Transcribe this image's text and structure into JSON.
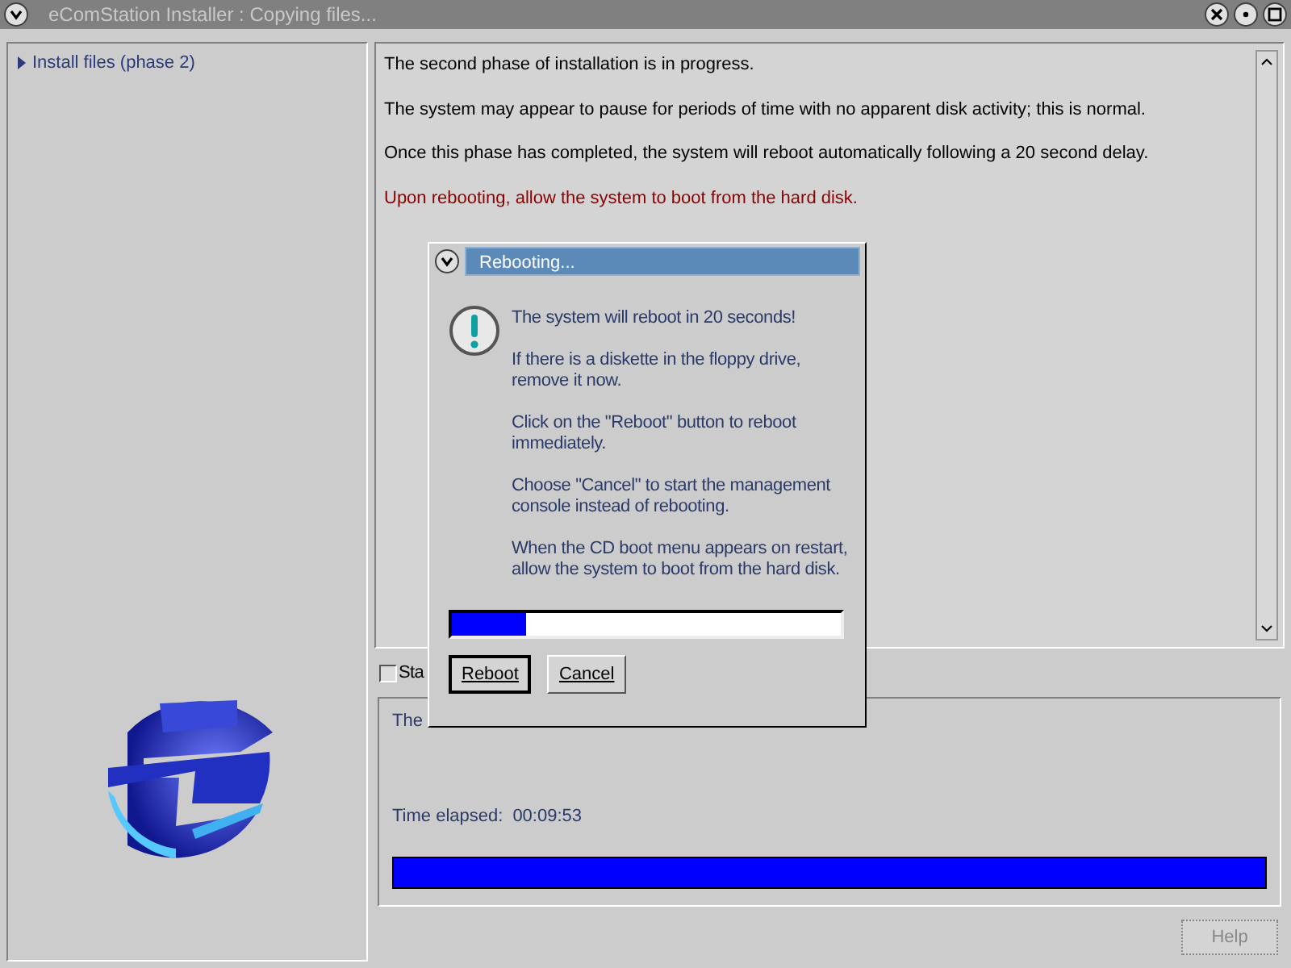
{
  "window": {
    "title": "eComStation Installer : Copying files..."
  },
  "sidebar": {
    "items": [
      {
        "label": "Install files (phase 2)",
        "selected": true
      }
    ]
  },
  "messages": [
    {
      "text": "The second phase of installation is in progress.",
      "kind": "normal"
    },
    {
      "text": "The system may appear to pause for periods of time with no apparent disk activity; this is normal.",
      "kind": "normal"
    },
    {
      "text": "Once this phase has completed, the system will reboot automatically following a 20 second delay.",
      "kind": "normal"
    },
    {
      "text": "Upon rebooting, allow the system to boot from the hard disk.",
      "kind": "warning"
    }
  ],
  "checkbox": {
    "label": "Sta",
    "checked": false
  },
  "status": {
    "text": "The",
    "elapsed_label": "Time elapsed:",
    "elapsed": "00:09:53",
    "level": 1
  },
  "help_button": {
    "label": "Help",
    "disabled": true
  },
  "dialog": {
    "title": "Rebooting...",
    "paragraphs": [
      "The system will reboot in 20 seconds!",
      "If there is a diskette in the floppy drive, remove it now.",
      "Click on the \"Reboot\" button to reboot immediately.",
      "Choose \"Cancel\" to start the management console instead of rebooting.",
      "When the CD boot menu appears on restart, allow the system to boot from the hard disk."
    ],
    "level": 0.19,
    "buttons": [
      {
        "label": "Reboot",
        "default": true
      },
      {
        "label": "Cancel",
        "default": false
      }
    ]
  }
}
